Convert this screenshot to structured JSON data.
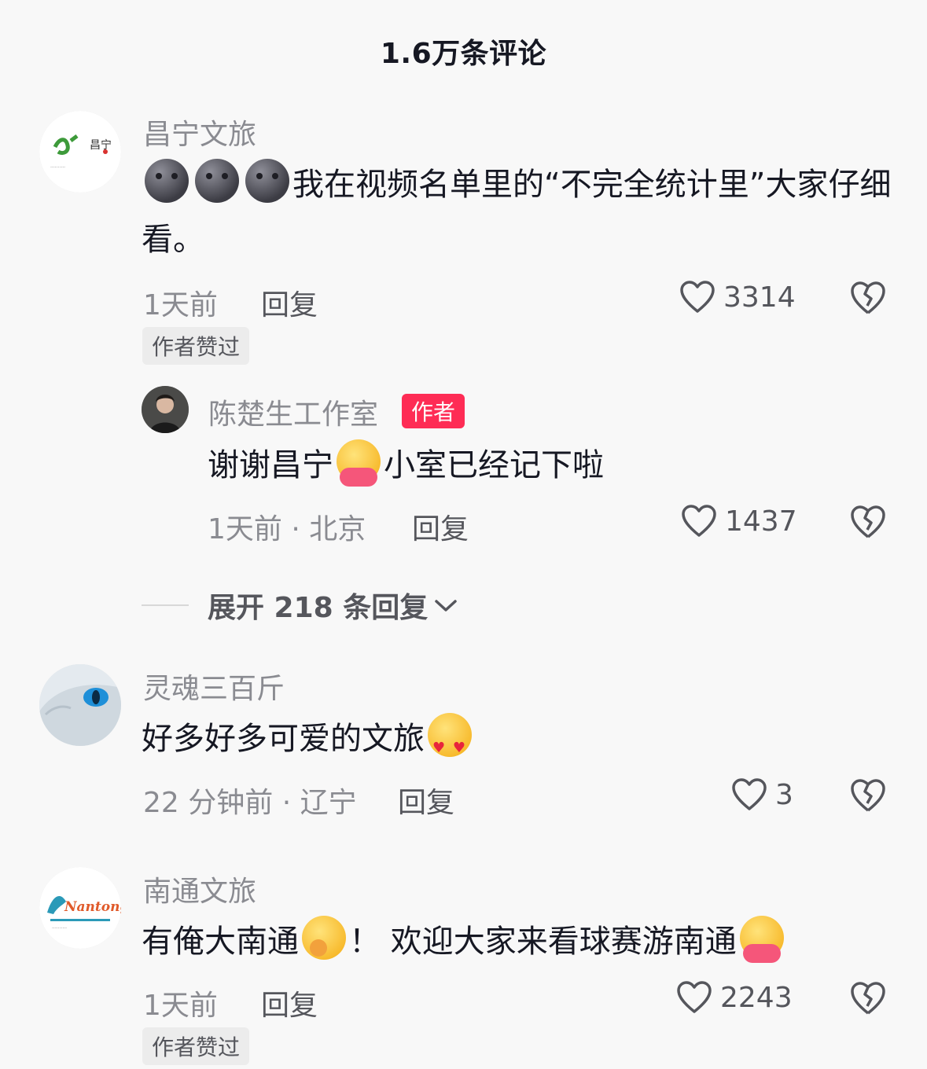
{
  "header": {
    "title": "1.6万条评论"
  },
  "comments": [
    {
      "username": "昌宁文旅",
      "avatar_text": "昌宁",
      "text": "我在视频名单里的“不完全统计里”大家仔细看。",
      "time": "1天前",
      "reply_label": "回复",
      "likes": "3314",
      "badge": "作者赞过",
      "author_reply": {
        "username": "陈楚生工作室",
        "tag": "作者",
        "text_before": "谢谢昌宁",
        "text_after": "小室已经记下啦",
        "meta": "1天前 · 北京",
        "reply_label": "回复",
        "likes": "1437"
      },
      "expand_label": "展开 218 条回复"
    },
    {
      "username": "灵魂三百斤",
      "text": "好多好多可爱的文旅",
      "meta": "22 分钟前 · 辽宁",
      "reply_label": "回复",
      "likes": "3"
    },
    {
      "username": "南通文旅",
      "avatar_text": "Nantong",
      "text_part1": "有俺大南通",
      "text_part2": "！ 欢迎大家来看球赛游南通",
      "time": "1天前",
      "reply_label": "回复",
      "likes": "2243",
      "badge": "作者赞过"
    }
  ],
  "colors": {
    "accent": "#fe2c55",
    "secondary_text": "#8a8b91",
    "background": "#f8f8f8"
  }
}
